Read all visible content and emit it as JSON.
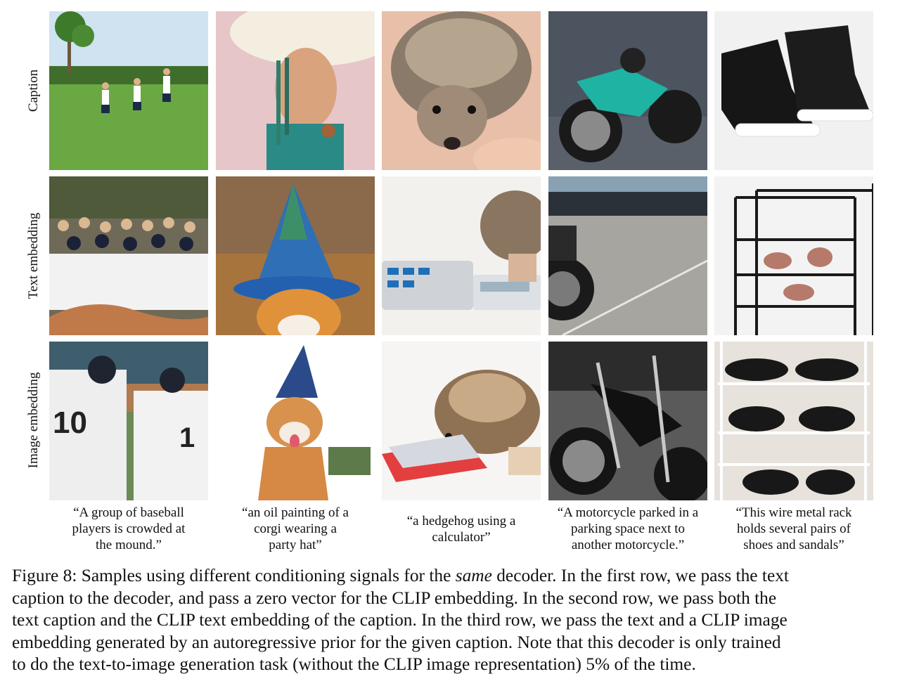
{
  "row_labels": [
    "Caption",
    "Text embedding",
    "Image embedding"
  ],
  "captions": [
    [
      "“A group of baseball",
      "players is crowded at",
      "the mound.”"
    ],
    [
      "“an oil painting of a",
      "corgi wearing a",
      "party hat”"
    ],
    [
      "“a hedgehog using a",
      "calculator”"
    ],
    [
      "“A motorcycle parked in a",
      "parking space next to",
      "another motorcycle.”"
    ],
    [
      "“This wire metal rack",
      "holds several pairs of",
      "shoes and sandals”"
    ]
  ],
  "figure_caption": {
    "line1_a": "Figure 8: Samples using different conditioning signals for the ",
    "line1_em": "same",
    "line1_b": " decoder. In the first row, we pass the text",
    "line2": "caption to the decoder, and pass a zero vector for the CLIP embedding. In the second row, we pass both the",
    "line3": "text caption and the CLIP text embedding of the caption. In the third row, we pass the text and a CLIP image",
    "line4": "embedding generated by an autoregressive prior for the given caption. Note that this decoder is only trained",
    "line5": "to do the text-to-image generation task (without the CLIP image representation) 5% of the time."
  }
}
